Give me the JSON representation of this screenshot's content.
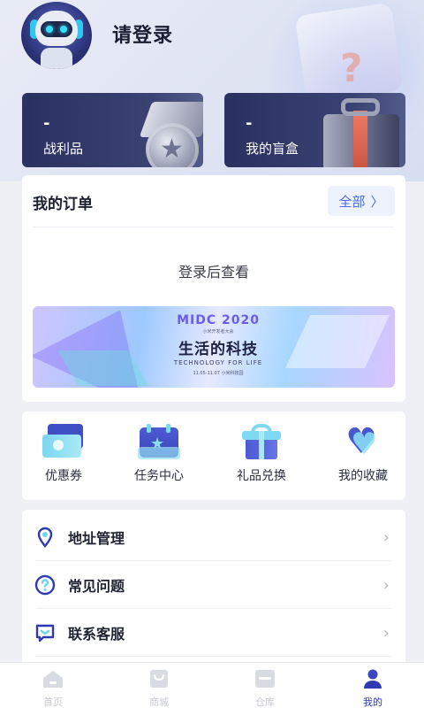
{
  "header": {
    "login_prompt": "请登录"
  },
  "cards": [
    {
      "value": "-",
      "label": "战利品"
    },
    {
      "value": "-",
      "label": "我的盲盒"
    }
  ],
  "orders": {
    "title": "我的订单",
    "all_label": "全部",
    "empty_text": "登录后查看"
  },
  "banner": {
    "brand": "MIDC 2020",
    "subtitle": "小米开发者大会",
    "headline": "生活的科技",
    "tagline": "TECHNOLOGY FOR LIFE",
    "date": "11.05-11.07 小米科技园",
    "colors": {
      "purple": "#6b5de8",
      "accent": "#ff8a3c"
    }
  },
  "shortcuts": [
    {
      "label": "优惠券",
      "icon": "coupon-icon"
    },
    {
      "label": "任务中心",
      "icon": "task-calendar-icon"
    },
    {
      "label": "礼品兑换",
      "icon": "gift-icon"
    },
    {
      "label": "我的收藏",
      "icon": "heart-icon"
    }
  ],
  "menu": [
    {
      "label": "地址管理",
      "icon": "location-pin-icon"
    },
    {
      "label": "常见问题",
      "icon": "question-icon"
    },
    {
      "label": "联系客服",
      "icon": "chat-icon"
    }
  ],
  "nav": {
    "items": [
      {
        "label": "首页",
        "icon": "home-icon"
      },
      {
        "label": "商城",
        "icon": "shop-bag-icon"
      },
      {
        "label": "仓库",
        "icon": "warehouse-icon"
      },
      {
        "label": "我的",
        "icon": "user-icon",
        "active": true
      }
    ],
    "active_color": "#2f3bb3"
  }
}
